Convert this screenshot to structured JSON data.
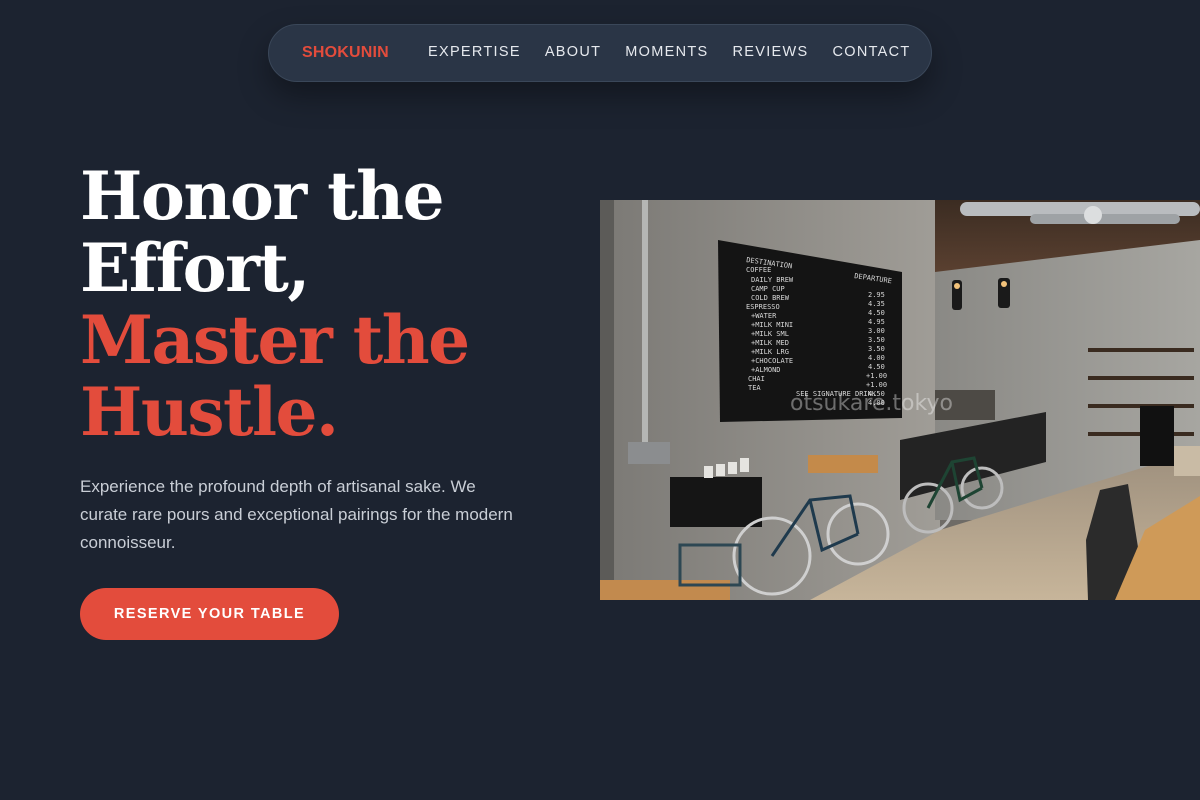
{
  "nav": {
    "brand": "SHOKUNIN",
    "links": [
      "EXPERTISE",
      "ABOUT",
      "MOMENTS",
      "REVIEWS",
      "CONTACT"
    ]
  },
  "hero": {
    "headline_white_1": "Honor the",
    "headline_white_2": "Effort,",
    "headline_red_1": "Master the",
    "headline_red_2": "Hustle.",
    "lede": "Experience the profound depth of artisanal sake. We curate rare pours and exceptional pairings for the modern connoisseur.",
    "cta": "RESERVE YOUR TABLE"
  },
  "photo": {
    "board_title": "DESTINATION",
    "board_departure": "DEPARTURE",
    "board_items": [
      "COFFEE",
      "DAILY BREW",
      "CAMP CUP",
      "COLD BREW",
      "ESPRESSO",
      "+WATER",
      "+MILK MINI",
      "+MILK SML",
      "+MILK MED",
      "+MILK LRG",
      "+CHOCOLATE",
      "+ALMOND",
      "CHAI",
      "TEA"
    ],
    "board_prices": [
      "2.95",
      "4.35",
      "4.50",
      "4.95",
      "3.00",
      "3.50",
      "3.50",
      "4.00",
      "4.50",
      "+1.00",
      "+1.00",
      "4.50",
      "4.00"
    ],
    "board_footer": "SEE SIGNATURE DRINK",
    "watermark": "otsukare.tokyo"
  },
  "colors": {
    "background": "#1c2330",
    "accent": "#e34c3c",
    "nav_bg": "#2a3546"
  }
}
